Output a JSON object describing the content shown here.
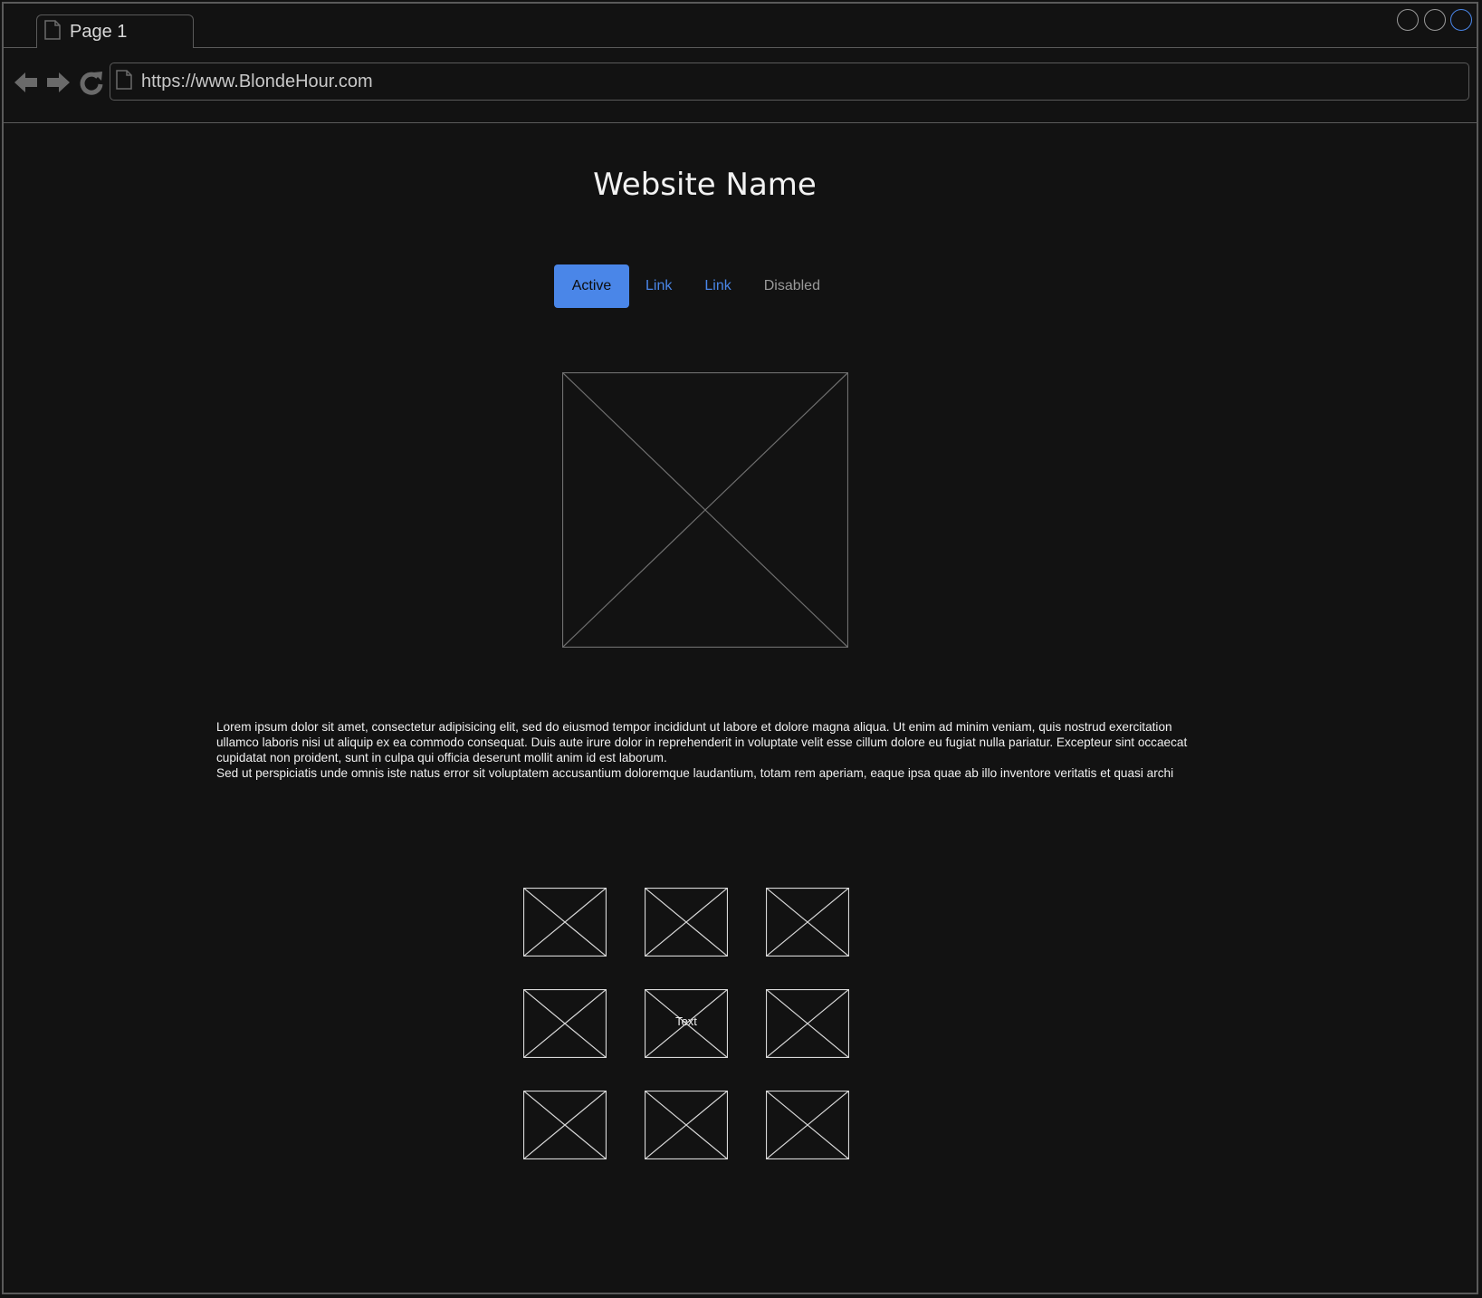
{
  "browser": {
    "tab_label": "Page 1",
    "url": "https://www.BlondeHour.com",
    "accent_color": "#4a86e8"
  },
  "icons": {
    "tab": "page-icon",
    "back": "arrow-left-icon",
    "forward": "arrow-right-icon",
    "reload": "reload-icon",
    "address": "page-icon",
    "image_placeholder": "image-placeholder-icon"
  },
  "site": {
    "title": "Website Name",
    "nav": [
      {
        "label": "Active",
        "state": "active"
      },
      {
        "label": "Link",
        "state": "link"
      },
      {
        "label": "Link",
        "state": "link"
      },
      {
        "label": "Disabled",
        "state": "disabled"
      }
    ],
    "paragraph": "Lorem ipsum dolor sit amet, consectetur adipisicing elit, sed do eiusmod tempor incididunt ut labore et dolore magna aliqua. Ut enim ad minim veniam, quis nostrud exercitation ullamco laboris nisi ut aliquip ex ea commodo consequat. Duis aute irure dolor in reprehenderit in voluptate velit esse cillum dolore eu fugiat nulla pariatur. Excepteur sint occaecat cupidatat non proident, sunt in culpa qui officia deserunt mollit anim id est laborum.\nSed ut perspiciatis unde omnis iste natus error sit voluptatem accusantium doloremque laudantium, totam rem aperiam, eaque ipsa quae ab illo inventore veritatis et quasi archi",
    "thumbnail_label": "Text"
  }
}
